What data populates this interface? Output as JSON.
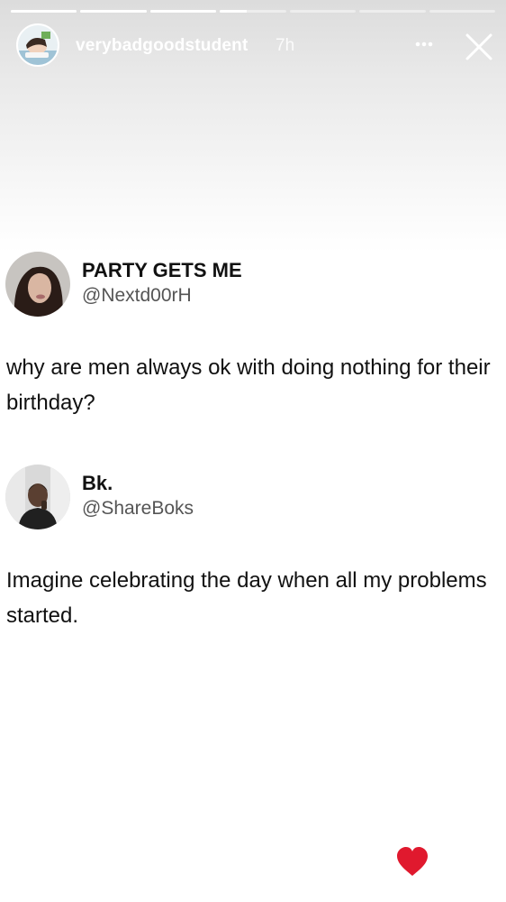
{
  "story": {
    "username": "verybadgoodstudent",
    "time": "7h",
    "progress_segments": [
      1,
      1,
      1,
      0.4,
      0,
      0,
      0
    ]
  },
  "tweets": [
    {
      "name": "PARTY GETS ME",
      "handle": "@Nextd00rH",
      "text": "why are men always ok with doing nothing for their birthday?"
    },
    {
      "name": "Bk.",
      "handle": "@ShareBoks",
      "text": "Imagine celebrating the day when all my problems started."
    }
  ],
  "icons": {
    "more": "more-horizontal-icon",
    "close": "close-icon",
    "like": "heart-icon"
  },
  "colors": {
    "like": "#e0192e"
  }
}
